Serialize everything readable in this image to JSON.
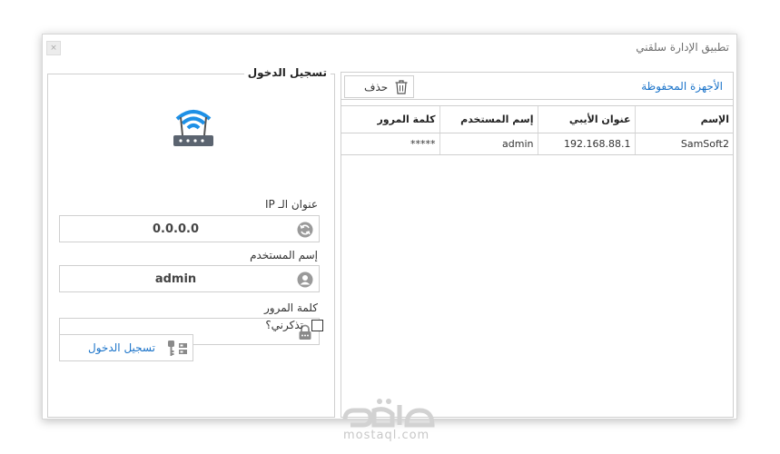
{
  "window": {
    "title": "تطبيق الإدارة سلقني",
    "close_glyph": "×"
  },
  "devices": {
    "title": "الأجهزة المحفوظة",
    "delete_label": "حذف",
    "columns": [
      "الإسم",
      "عنوان الأيبي",
      "إسم المستخدم",
      "كلمة المرور"
    ],
    "rows": [
      {
        "name": "SamSoft2",
        "ip": "192.168.88.1",
        "username": "admin",
        "password": "*****"
      }
    ]
  },
  "login": {
    "group_title": "تسجيل الدخول",
    "ip_label": "عنوان الـ IP",
    "ip_value": "0.0.0.0",
    "username_label": "إسم المستخدم",
    "username_value": "admin",
    "password_label": "كلمة المرور",
    "password_value": "",
    "remember_label": "تذكرني؟",
    "remember_checked": false,
    "login_button": "تسجيل الدخول"
  },
  "watermark": {
    "text": "mostaql.com"
  },
  "colors": {
    "accent": "#1a73c9",
    "border": "#cfcfcf",
    "wifi": "#1e90e6"
  },
  "icons": [
    "router-wifi-icon",
    "refresh-icon",
    "user-icon",
    "lock-icon",
    "trash-icon",
    "keys-icon"
  ]
}
